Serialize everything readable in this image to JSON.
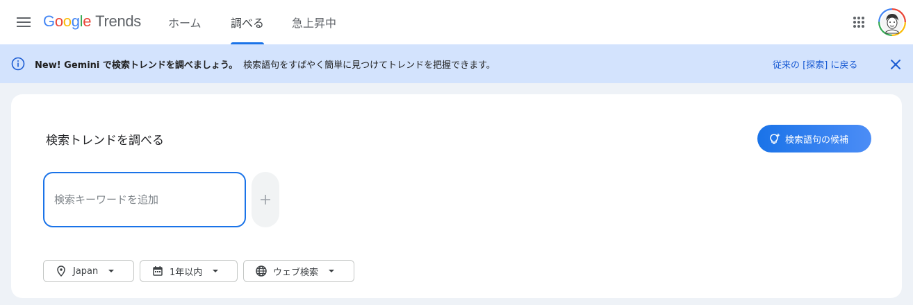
{
  "header": {
    "logo_google": [
      "G",
      "o",
      "o",
      "g",
      "l",
      "e"
    ],
    "logo_google_colors": [
      "#4285f4",
      "#ea4335",
      "#fbbc05",
      "#4285f4",
      "#34a853",
      "#ea4335"
    ],
    "logo_trends": "Trends",
    "tabs": [
      {
        "label": "ホーム",
        "active": false
      },
      {
        "label": "調べる",
        "active": true
      },
      {
        "label": "急上昇中",
        "active": false
      }
    ],
    "icons": {
      "menu": "hamburger-menu-icon",
      "apps": "apps-grid-icon",
      "avatar": "user-avatar"
    }
  },
  "banner": {
    "bold_text": "New! Gemini で検索トレンドを調べましょう。",
    "text": "検索語句をすばやく簡単に見つけてトレンドを把握できます。",
    "link": "従来の [探索] に戻る",
    "bg_color": "#d3e3fd"
  },
  "explore": {
    "title": "検索トレンドを調べる",
    "suggest_button": "検索語句の候補",
    "search_placeholder": "検索キーワードを追加",
    "search_value": "",
    "filters": [
      {
        "label": "Japan",
        "icon": "location-pin-icon"
      },
      {
        "label": "1年以内",
        "icon": "calendar-icon"
      },
      {
        "label": "ウェブ検索",
        "icon": "globe-icon"
      }
    ]
  },
  "colors": {
    "accent": "#1a73e8",
    "page_bg": "#eef2f7"
  }
}
